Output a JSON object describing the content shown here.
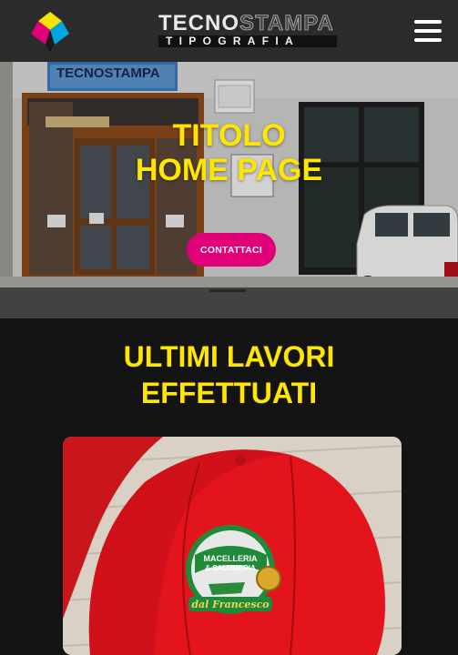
{
  "header": {
    "brand_top_1": "TECNO",
    "brand_top_2": "STAMPA",
    "brand_sub": "TIPOGRAFIA",
    "logo_icon": "cmyk-cube-logo",
    "menu_icon": "hamburger-menu-icon"
  },
  "hero": {
    "title_line1": "TITOLO",
    "title_line2": "HOME PAGE",
    "cta_label": "CONTATTACI",
    "sign_text": "TECNOSTAMPA",
    "colors": {
      "title": "#ffe600",
      "cta": "#e20078"
    }
  },
  "works": {
    "title_line1": "ULTIMI LAVORI",
    "title_line2": "EFFETTUATI",
    "item_caption": "dal Francesco",
    "item_badge_line1": "MACELLERIA",
    "item_badge_line2": "& SALUMERIA"
  }
}
